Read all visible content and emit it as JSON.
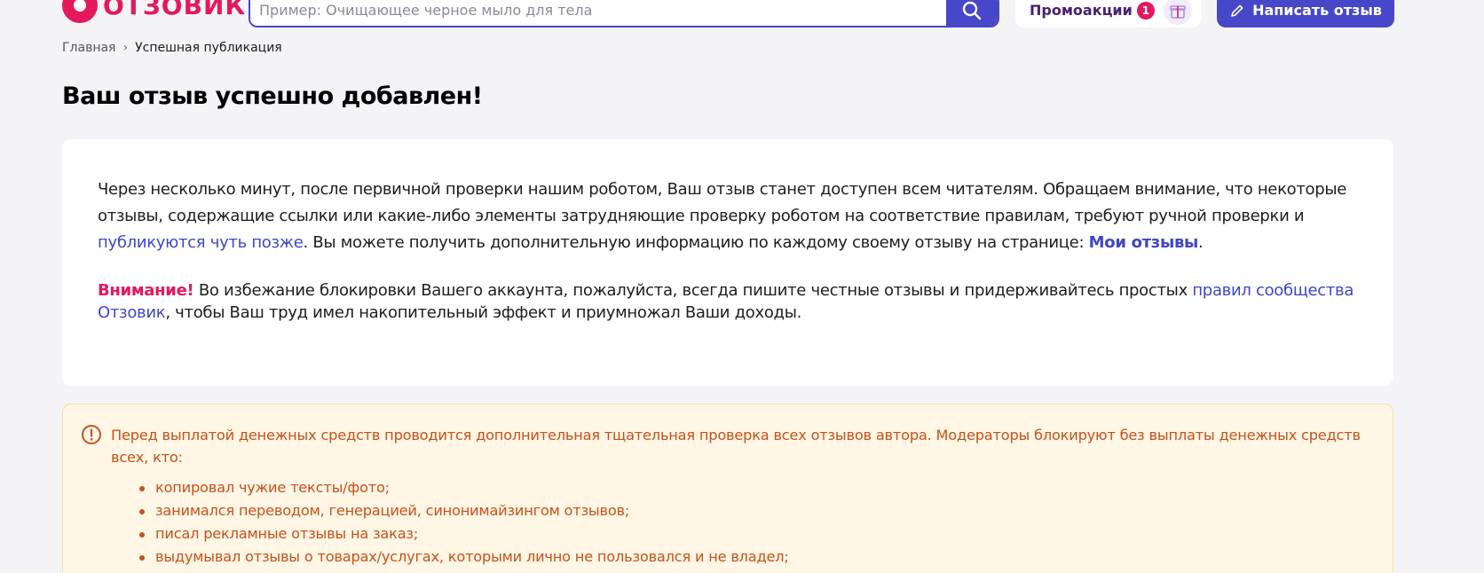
{
  "header": {
    "logo_text": "ОТЗОВИК",
    "search_placeholder": "Пример: Очищающее черное мыло для тела",
    "promo_label": "Промоакции",
    "promo_count": "1",
    "write_label": "Написать отзыв"
  },
  "breadcrumb": {
    "home": "Главная",
    "separator": "›",
    "current": "Успешная публикация"
  },
  "page_title": "Ваш отзыв успешно добавлен!",
  "info": {
    "p1_text1": "Через несколько минут, после первичной проверки нашим роботом, Ваш отзыв станет доступен всем читателям. Обращаем внимание, что некоторые отзывы, содержащие ссылки или какие-либо элементы затрудняющие проверку роботом на соответствие правилам, требуют ручной проверки и ",
    "p1_link": "публикуются чуть позже",
    "p1_text2": ". Вы можете получить дополнительную информацию по каждому своему отзыву на странице: ",
    "p1_link2": "Мои отзывы",
    "p1_end": ".",
    "attention": "Внимание!",
    "p2_text1": " Во избежание блокировки Вашего аккаунта, пожалуйста, всегда пишите честные отзывы и придерживайтесь простых ",
    "p2_link": "правил сообщества Отзовик",
    "p2_text2": ", чтобы Ваш труд имел накопительный эффект и приумножал Ваши доходы."
  },
  "warning": {
    "text": "Перед выплатой денежных средств проводится дополнительная тщательная проверка всех отзывов автора. Модераторы блокируют без выплаты денежных средств всех, кто:",
    "items": [
      "копировал чужие тексты/фото;",
      "занимался переводом, генерацией, синонимайзингом отзывов;",
      "писал рекламные отзывы на заказ;",
      "выдумывал отзывы о товарах/услугах, которыми лично не пользовался и не владел;"
    ]
  },
  "colors": {
    "brand": "#e5185c",
    "accent": "#4747c9",
    "warning_text": "#c7511a",
    "warning_bg": "#fff6e5"
  }
}
